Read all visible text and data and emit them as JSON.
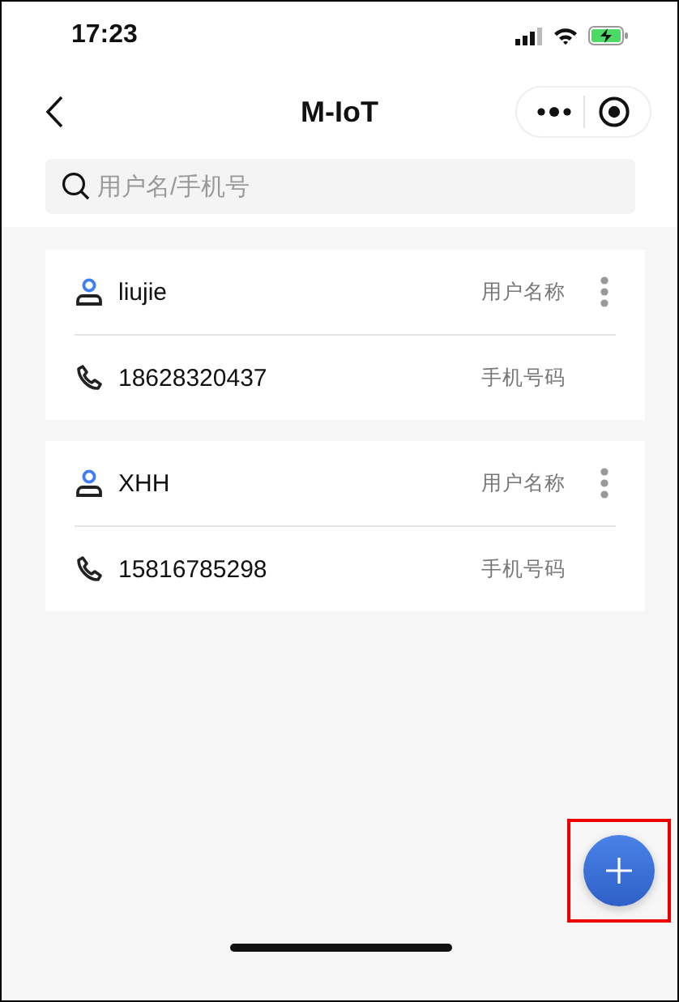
{
  "status_bar": {
    "time": "17:23"
  },
  "nav": {
    "title": "M-IoT"
  },
  "search": {
    "placeholder": "用户名/手机号"
  },
  "users": [
    {
      "name": "liujie",
      "name_label": "用户名称",
      "phone": "18628320437",
      "phone_label": "手机号码"
    },
    {
      "name": "XHH",
      "name_label": "用户名称",
      "phone": "15816785298",
      "phone_label": "手机号码"
    }
  ]
}
